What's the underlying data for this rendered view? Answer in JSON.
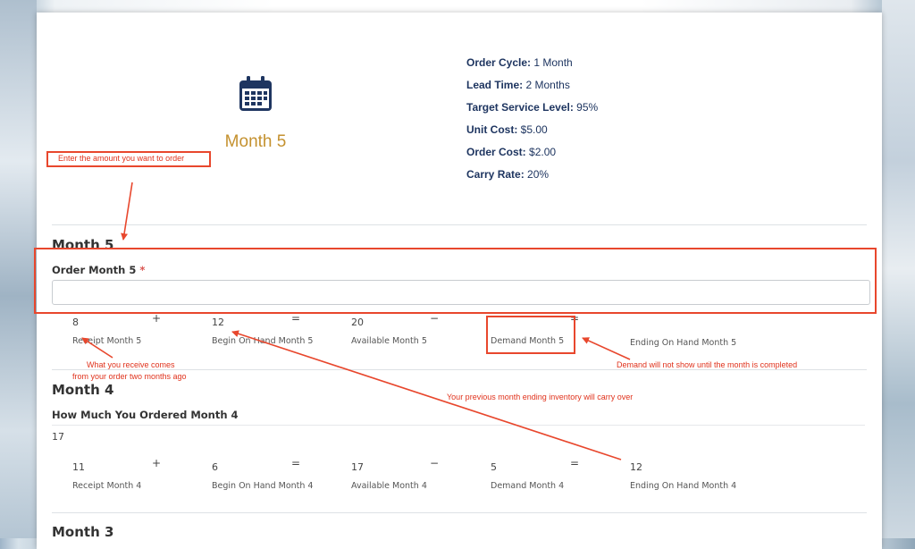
{
  "header": {
    "month_title": "Month 5",
    "info": [
      {
        "label": "Order Cycle:",
        "value": " 1 Month"
      },
      {
        "label": "Lead Time:",
        "value": " 2 Months"
      },
      {
        "label": "Target Service Level:",
        "value": " 95%"
      },
      {
        "label": "Unit Cost:",
        "value": " $5.00"
      },
      {
        "label": "Order Cost:",
        "value": " $2.00"
      },
      {
        "label": "Carry Rate:",
        "value": " 20%"
      }
    ]
  },
  "month5": {
    "heading": "Month 5",
    "order_label": "Order Month 5",
    "required_mark": "*",
    "order_value": "",
    "receipt": "8",
    "begin_on_hand": "12",
    "available": "20",
    "demand": "",
    "ending": "",
    "ops": [
      "+",
      "=",
      "−",
      "="
    ],
    "captions": [
      "Receipt Month 5",
      "Begin On Hand Month 5",
      "Available Month 5",
      "Demand Month 5",
      "Ending On Hand Month 5"
    ]
  },
  "month4": {
    "heading": "Month 4",
    "ordered_label": "How Much You Ordered Month 4",
    "ordered_value": "17",
    "receipt": "11",
    "begin_on_hand": "6",
    "available": "17",
    "demand": "5",
    "ending": "12",
    "ops": [
      "+",
      "=",
      "−",
      "="
    ],
    "captions": [
      "Receipt Month 4",
      "Begin On Hand Month 4",
      "Available Month 4",
      "Demand Month 4",
      "Ending On Hand Month 4"
    ]
  },
  "month3": {
    "heading": "Month 3"
  },
  "annotations": {
    "enter_amount": "Enter the amount you want to order",
    "receive_line1": "What you receive comes",
    "receive_line2": "from your order two months ago",
    "carry_over": "Your previous month ending inventory will carry over",
    "demand_note": "Demand will not show until the month is completed"
  },
  "colors": {
    "accent": "#c4912f",
    "navy": "#1e3560",
    "annotation": "#e8472d"
  }
}
